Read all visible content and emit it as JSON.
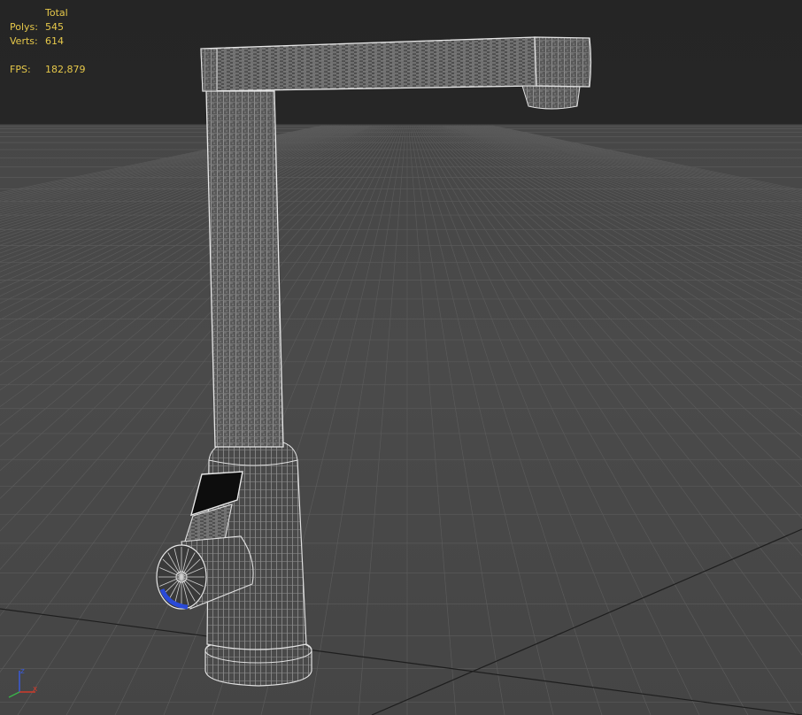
{
  "viewport": {
    "name": "Perspective viewport",
    "stats": {
      "header": "Total",
      "polys_label": "Polys:",
      "polys_value": "545",
      "verts_label": "Verts:",
      "verts_value": "614",
      "fps_label": "FPS:",
      "fps_value": "182,879"
    },
    "gizmo": {
      "x_label": "x",
      "z_label": "z"
    },
    "colors": {
      "stats_text": "#e6c84a",
      "background_top": "#262626",
      "grid_plane": "#4a4a4a",
      "grid_line": "#5a5a5a",
      "wire": "#d8d8d8",
      "axis_x": "#d03a2a",
      "axis_y": "#3ab04a",
      "axis_z": "#3a5ad8",
      "selection_blue": "#2a4ad8"
    },
    "object": "faucet-model"
  }
}
